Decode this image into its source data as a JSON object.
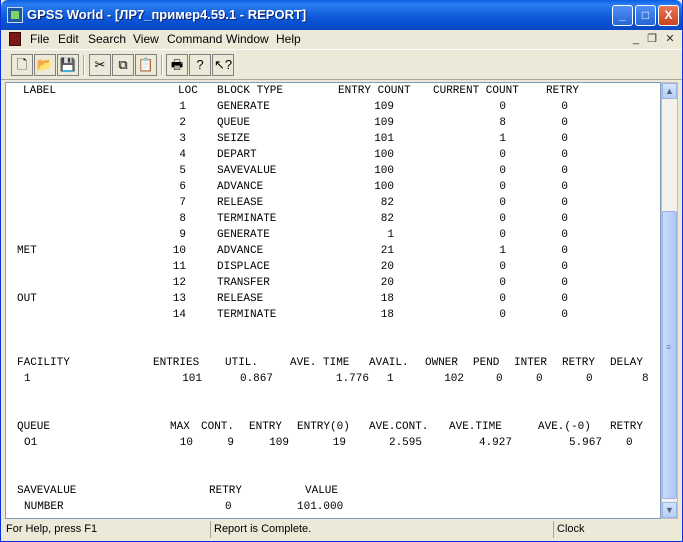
{
  "window": {
    "title": "GPSS World - [ЛР7_пример4.59.1  -  REPORT]",
    "min": "_",
    "max": "□",
    "close": "X"
  },
  "menu": [
    {
      "id": "file",
      "label": "File"
    },
    {
      "id": "edit",
      "label": "Edit"
    },
    {
      "id": "search",
      "label": "Search"
    },
    {
      "id": "view",
      "label": "View"
    },
    {
      "id": "command",
      "label": "Command"
    },
    {
      "id": "window",
      "label": "Window"
    },
    {
      "id": "help",
      "label": "Help"
    }
  ],
  "mdi": {
    "min": "_",
    "restore": "❐",
    "close": "✕"
  },
  "toolbar": [
    {
      "id": "new",
      "icon": "new-document-icon",
      "glyph": "🗋"
    },
    {
      "id": "open",
      "icon": "open-folder-icon",
      "glyph": "📂"
    },
    {
      "id": "save",
      "icon": "save-disk-icon",
      "glyph": "💾"
    },
    {
      "id": "cut",
      "icon": "scissors-icon",
      "glyph": "✂"
    },
    {
      "id": "copy",
      "icon": "copy-icon",
      "glyph": "⧉"
    },
    {
      "id": "paste",
      "icon": "paste-icon",
      "glyph": "📋"
    },
    {
      "id": "print",
      "icon": "printer-icon",
      "glyph": "🖶"
    },
    {
      "id": "help",
      "icon": "help-question-icon",
      "glyph": "?"
    },
    {
      "id": "context-help",
      "icon": "context-help-icon",
      "glyph": "↖?"
    }
  ],
  "report": {
    "blocks_header": {
      "label": "LABEL",
      "loc": "LOC",
      "block_type": "BLOCK TYPE",
      "entry_count": "ENTRY COUNT",
      "current_count": "CURRENT COUNT",
      "retry": "RETRY"
    },
    "blocks": [
      {
        "label": "",
        "loc": "1",
        "type": "GENERATE",
        "entry": "109",
        "current": "0",
        "retry": "0"
      },
      {
        "label": "",
        "loc": "2",
        "type": "QUEUE",
        "entry": "109",
        "current": "8",
        "retry": "0"
      },
      {
        "label": "",
        "loc": "3",
        "type": "SEIZE",
        "entry": "101",
        "current": "1",
        "retry": "0"
      },
      {
        "label": "",
        "loc": "4",
        "type": "DEPART",
        "entry": "100",
        "current": "0",
        "retry": "0"
      },
      {
        "label": "",
        "loc": "5",
        "type": "SAVEVALUE",
        "entry": "100",
        "current": "0",
        "retry": "0"
      },
      {
        "label": "",
        "loc": "6",
        "type": "ADVANCE",
        "entry": "100",
        "current": "0",
        "retry": "0"
      },
      {
        "label": "",
        "loc": "7",
        "type": "RELEASE",
        "entry": "82",
        "current": "0",
        "retry": "0"
      },
      {
        "label": "",
        "loc": "8",
        "type": "TERMINATE",
        "entry": "82",
        "current": "0",
        "retry": "0"
      },
      {
        "label": "",
        "loc": "9",
        "type": "GENERATE",
        "entry": "1",
        "current": "0",
        "retry": "0"
      },
      {
        "label": "MET",
        "loc": "10",
        "type": "ADVANCE",
        "entry": "21",
        "current": "1",
        "retry": "0"
      },
      {
        "label": "",
        "loc": "11",
        "type": "DISPLACE",
        "entry": "20",
        "current": "0",
        "retry": "0"
      },
      {
        "label": "",
        "loc": "12",
        "type": "TRANSFER",
        "entry": "20",
        "current": "0",
        "retry": "0"
      },
      {
        "label": "OUT",
        "loc": "13",
        "type": "RELEASE",
        "entry": "18",
        "current": "0",
        "retry": "0"
      },
      {
        "label": "",
        "loc": "14",
        "type": "TERMINATE",
        "entry": "18",
        "current": "0",
        "retry": "0"
      }
    ],
    "facility_header": {
      "facility": "FACILITY",
      "entries": "ENTRIES",
      "util": "UTIL.",
      "ave_time": "AVE. TIME",
      "avail": "AVAIL.",
      "owner": "OWNER",
      "pend": "PEND",
      "inter": "INTER",
      "retry": "RETRY",
      "delay": "DELAY"
    },
    "facility_row": {
      "facility": "1",
      "entries": "101",
      "util": "0.867",
      "ave_time": "1.776",
      "avail": "1",
      "owner": "102",
      "pend": "0",
      "inter": "0",
      "retry": "0",
      "delay": "8"
    },
    "queue_header": {
      "queue": "QUEUE",
      "max": "MAX",
      "cont": "CONT.",
      "entry": "ENTRY",
      "entry0": "ENTRY(0)",
      "ave_cont": "AVE.CONT.",
      "ave_time": "AVE.TIME",
      "ave_0": "AVE.(-0)",
      "retry": "RETRY"
    },
    "queue_row": {
      "queue": "O1",
      "max": "10",
      "cont": "9",
      "entry": "109",
      "entry0": "19",
      "ave_cont": "2.595",
      "ave_time": "4.927",
      "ave_0": "5.967",
      "retry": "0"
    },
    "savevalue_header": {
      "savevalue": "SAVEVALUE",
      "retry": "RETRY",
      "value": "VALUE"
    },
    "savevalue_row": {
      "name": "NUMBER",
      "retry": "0",
      "value": "101.000"
    }
  },
  "scrollbar": {
    "up": "▲",
    "down": "▼",
    "thumb_grip": "≡"
  },
  "status": {
    "help": "For Help, press F1",
    "message": "Report is Complete.",
    "clock": "Clock"
  }
}
